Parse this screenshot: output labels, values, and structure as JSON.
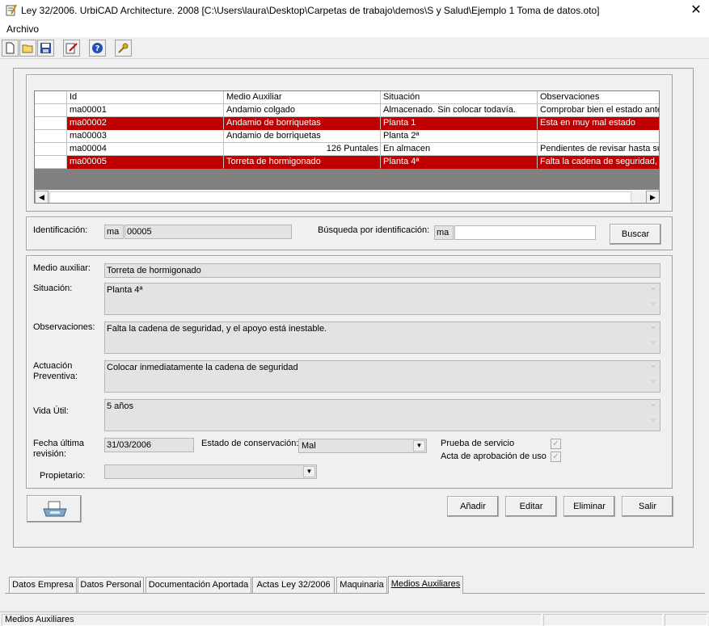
{
  "window": {
    "title": "Ley 32/2006. UrbiCAD Architecture. 2008 [C:\\Users\\laura\\Desktop\\Carpetas de trabajo\\demos\\S y Salud\\Ejemplo 1 Toma de datos.oto]",
    "close": "✕"
  },
  "menu": {
    "archivo": "Archivo"
  },
  "toolbar": [
    "new-file-icon",
    "open-folder-icon",
    "save-icon",
    "edit-icon",
    "help-icon",
    "key-icon"
  ],
  "grid": {
    "columns": [
      "Id",
      "Medio Auxiliar",
      "Situación",
      "Observaciones"
    ],
    "rows": [
      {
        "id": "ma00001",
        "medio": "Andamio colgado",
        "situacion": "Almacenado. Sin colocar todavía.",
        "obs": "Comprobar bien el estado antes",
        "selected": false
      },
      {
        "id": "ma00002",
        "medio": "Andamio de borriquetas",
        "situacion": "Planta 1",
        "obs": "Esta en muy mal estado",
        "selected": true
      },
      {
        "id": "ma00003",
        "medio": "Andamio de borriquetas",
        "situacion": "Planta 2ª",
        "obs": "",
        "selected": false
      },
      {
        "id": "ma00004",
        "medio": "126 Puntales",
        "situacion": "En almacen",
        "obs": "Pendientes de revisar hasta su",
        "selected": false
      },
      {
        "id": "ma00005",
        "medio": "Torreta de hormigonado",
        "situacion": "Planta 4ª",
        "obs": "Falta la cadena de seguridad, y",
        "selected": true
      }
    ]
  },
  "ident": {
    "label": "Identificación:",
    "prefix": "ma",
    "value": "00005",
    "search_label": "Búsqueda por  identificación:",
    "search_prefix": "ma",
    "search_value": "",
    "search_button": "Buscar"
  },
  "detail": {
    "medio_label": "Medio auxiliar:",
    "medio": "Torreta de hormigonado",
    "situacion_label": "Situación:",
    "situacion": "Planta 4ª",
    "obs_label": "Observaciones:",
    "obs": "Falta la cadena de seguridad, y el apoyo está inestable.",
    "actuacion_label_1": "Actuación",
    "actuacion_label_2": "Preventiva:",
    "actuacion": "Colocar inmediatamente la cadena de seguridad",
    "vida_label": "Vida Útil:",
    "vida": "5 años",
    "fecha_label_1": "Fecha última",
    "fecha_label_2": "revisión:",
    "fecha": "31/03/2006",
    "estado_label": "Estado de conservación:",
    "estado": "Mal",
    "prueba_label": "Prueba de servicio",
    "prueba_checked": true,
    "acta_label": "Acta de aprobación de uso",
    "acta_checked": true,
    "propietario_label": "Propietario:",
    "propietario": ""
  },
  "actions": {
    "add": "Añadir",
    "edit": "Editar",
    "delete": "Eliminar",
    "exit": "Salir"
  },
  "tabs": [
    "Datos Empresa",
    "Datos Personal",
    "Documentación Aportada",
    "Actas Ley 32/2006",
    "Maquinaria",
    "Medios Auxiliares"
  ],
  "active_tab": "Medios Auxiliares",
  "status": {
    "text": "Medios Auxiliares"
  },
  "colors": {
    "selection": "#c00000"
  }
}
